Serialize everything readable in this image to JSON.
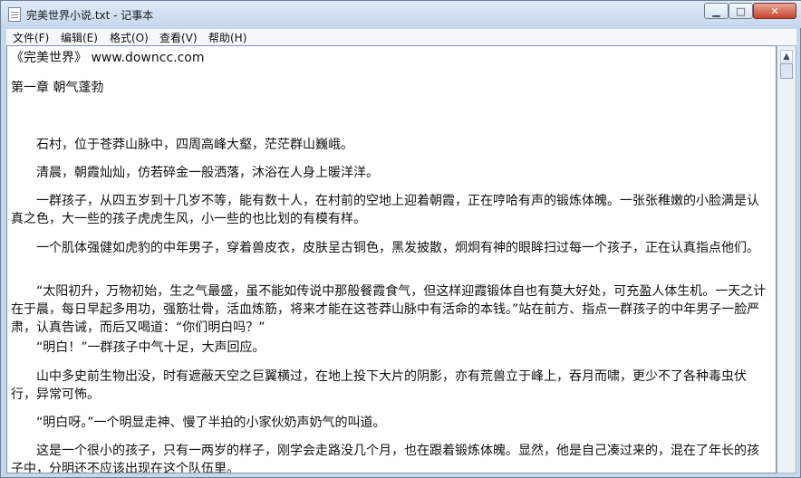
{
  "window": {
    "title": "完美世界小说.txt - 记事本"
  },
  "menu": {
    "items": [
      "文件(F)",
      "编辑(E)",
      "格式(O)",
      "查看(V)",
      "帮助(H)"
    ]
  },
  "document": {
    "header_line": "《完美世界》    www.downcc.com",
    "chapter": "第一章 朝气蓬勃",
    "paragraphs": [
      "石村，位于苍莽山脉中，四周高峰大壑，茫茫群山巍峨。",
      "清晨，朝霞灿灿，仿若碎金一般洒落，沐浴在人身上暖洋洋。",
      "一群孩子，从四五岁到十几岁不等，能有数十人，在村前的空地上迎着朝霞，正在哼哈有声的锻炼体魄。一张张稚嫩的小脸满是认真之色，大一些的孩子虎虎生风，小一些的也比划的有模有样。",
      "一个肌体强健如虎豹的中年男子，穿着兽皮衣，皮肤呈古铜色，黑发披散，炯炯有神的眼眸扫过每一个孩子，正在认真指点他们。",
      "“太阳初升，万物初始，生之气最盛，虽不能如传说中那般餐霞食气，但这样迎霞锻体自也有莫大好处，可充盈人体生机。一天之计在于晨，每日早起多用功，强筋壮骨，活血炼筋，将来才能在这苍莽山脉中有活命的本钱。”站在前方、指点一群孩子的中年男子一脸严肃，认真告诫，而后又喝道：“你们明白吗？”",
      "“明白！”一群孩子中气十足，大声回应。",
      "山中多史前生物出没，时有遮蔽天空之巨翼横过，在地上投下大片的阴影，亦有荒兽立于峰上，吞月而啸，更少不了各种毒虫伏行，异常可怖。",
      "“明白呀。”一个明显走神、慢了半拍的小家伙奶声奶气的叫道。",
      "这是一个很小的孩子，只有一两岁的样子，刚学会走路没几个月，也在跟着锻炼体魄。显然，他是自己凑过来的，混在了年长的孩子中，分明还不应该出现在这个队伍里。"
    ]
  }
}
